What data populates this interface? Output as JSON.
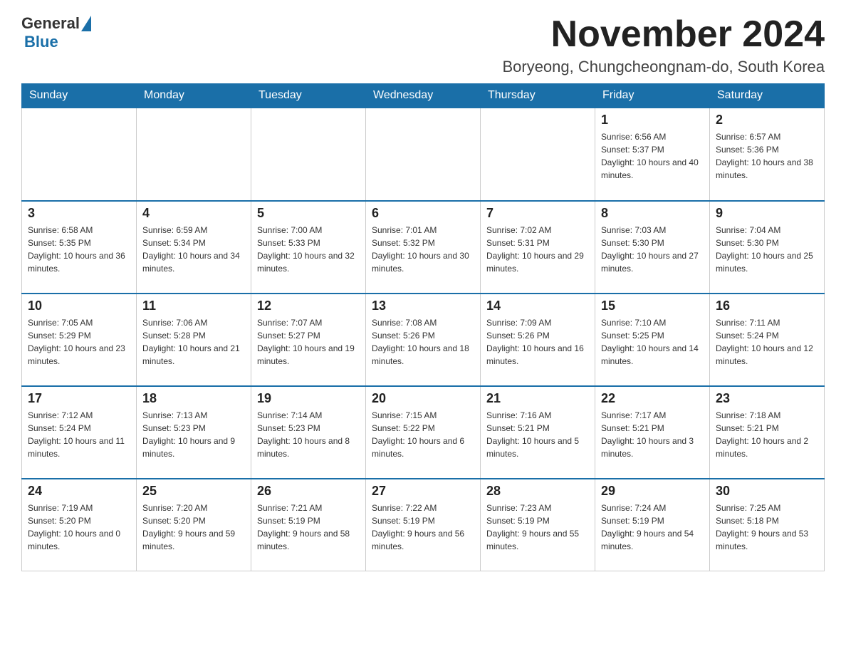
{
  "header": {
    "logo": {
      "general": "General",
      "blue": "Blue"
    },
    "title": "November 2024",
    "location": "Boryeong, Chungcheongnam-do, South Korea"
  },
  "columns": [
    "Sunday",
    "Monday",
    "Tuesday",
    "Wednesday",
    "Thursday",
    "Friday",
    "Saturday"
  ],
  "weeks": [
    [
      {
        "day": "",
        "sunrise": "",
        "sunset": "",
        "daylight": ""
      },
      {
        "day": "",
        "sunrise": "",
        "sunset": "",
        "daylight": ""
      },
      {
        "day": "",
        "sunrise": "",
        "sunset": "",
        "daylight": ""
      },
      {
        "day": "",
        "sunrise": "",
        "sunset": "",
        "daylight": ""
      },
      {
        "day": "",
        "sunrise": "",
        "sunset": "",
        "daylight": ""
      },
      {
        "day": "1",
        "sunrise": "Sunrise: 6:56 AM",
        "sunset": "Sunset: 5:37 PM",
        "daylight": "Daylight: 10 hours and 40 minutes."
      },
      {
        "day": "2",
        "sunrise": "Sunrise: 6:57 AM",
        "sunset": "Sunset: 5:36 PM",
        "daylight": "Daylight: 10 hours and 38 minutes."
      }
    ],
    [
      {
        "day": "3",
        "sunrise": "Sunrise: 6:58 AM",
        "sunset": "Sunset: 5:35 PM",
        "daylight": "Daylight: 10 hours and 36 minutes."
      },
      {
        "day": "4",
        "sunrise": "Sunrise: 6:59 AM",
        "sunset": "Sunset: 5:34 PM",
        "daylight": "Daylight: 10 hours and 34 minutes."
      },
      {
        "day": "5",
        "sunrise": "Sunrise: 7:00 AM",
        "sunset": "Sunset: 5:33 PM",
        "daylight": "Daylight: 10 hours and 32 minutes."
      },
      {
        "day": "6",
        "sunrise": "Sunrise: 7:01 AM",
        "sunset": "Sunset: 5:32 PM",
        "daylight": "Daylight: 10 hours and 30 minutes."
      },
      {
        "day": "7",
        "sunrise": "Sunrise: 7:02 AM",
        "sunset": "Sunset: 5:31 PM",
        "daylight": "Daylight: 10 hours and 29 minutes."
      },
      {
        "day": "8",
        "sunrise": "Sunrise: 7:03 AM",
        "sunset": "Sunset: 5:30 PM",
        "daylight": "Daylight: 10 hours and 27 minutes."
      },
      {
        "day": "9",
        "sunrise": "Sunrise: 7:04 AM",
        "sunset": "Sunset: 5:30 PM",
        "daylight": "Daylight: 10 hours and 25 minutes."
      }
    ],
    [
      {
        "day": "10",
        "sunrise": "Sunrise: 7:05 AM",
        "sunset": "Sunset: 5:29 PM",
        "daylight": "Daylight: 10 hours and 23 minutes."
      },
      {
        "day": "11",
        "sunrise": "Sunrise: 7:06 AM",
        "sunset": "Sunset: 5:28 PM",
        "daylight": "Daylight: 10 hours and 21 minutes."
      },
      {
        "day": "12",
        "sunrise": "Sunrise: 7:07 AM",
        "sunset": "Sunset: 5:27 PM",
        "daylight": "Daylight: 10 hours and 19 minutes."
      },
      {
        "day": "13",
        "sunrise": "Sunrise: 7:08 AM",
        "sunset": "Sunset: 5:26 PM",
        "daylight": "Daylight: 10 hours and 18 minutes."
      },
      {
        "day": "14",
        "sunrise": "Sunrise: 7:09 AM",
        "sunset": "Sunset: 5:26 PM",
        "daylight": "Daylight: 10 hours and 16 minutes."
      },
      {
        "day": "15",
        "sunrise": "Sunrise: 7:10 AM",
        "sunset": "Sunset: 5:25 PM",
        "daylight": "Daylight: 10 hours and 14 minutes."
      },
      {
        "day": "16",
        "sunrise": "Sunrise: 7:11 AM",
        "sunset": "Sunset: 5:24 PM",
        "daylight": "Daylight: 10 hours and 12 minutes."
      }
    ],
    [
      {
        "day": "17",
        "sunrise": "Sunrise: 7:12 AM",
        "sunset": "Sunset: 5:24 PM",
        "daylight": "Daylight: 10 hours and 11 minutes."
      },
      {
        "day": "18",
        "sunrise": "Sunrise: 7:13 AM",
        "sunset": "Sunset: 5:23 PM",
        "daylight": "Daylight: 10 hours and 9 minutes."
      },
      {
        "day": "19",
        "sunrise": "Sunrise: 7:14 AM",
        "sunset": "Sunset: 5:23 PM",
        "daylight": "Daylight: 10 hours and 8 minutes."
      },
      {
        "day": "20",
        "sunrise": "Sunrise: 7:15 AM",
        "sunset": "Sunset: 5:22 PM",
        "daylight": "Daylight: 10 hours and 6 minutes."
      },
      {
        "day": "21",
        "sunrise": "Sunrise: 7:16 AM",
        "sunset": "Sunset: 5:21 PM",
        "daylight": "Daylight: 10 hours and 5 minutes."
      },
      {
        "day": "22",
        "sunrise": "Sunrise: 7:17 AM",
        "sunset": "Sunset: 5:21 PM",
        "daylight": "Daylight: 10 hours and 3 minutes."
      },
      {
        "day": "23",
        "sunrise": "Sunrise: 7:18 AM",
        "sunset": "Sunset: 5:21 PM",
        "daylight": "Daylight: 10 hours and 2 minutes."
      }
    ],
    [
      {
        "day": "24",
        "sunrise": "Sunrise: 7:19 AM",
        "sunset": "Sunset: 5:20 PM",
        "daylight": "Daylight: 10 hours and 0 minutes."
      },
      {
        "day": "25",
        "sunrise": "Sunrise: 7:20 AM",
        "sunset": "Sunset: 5:20 PM",
        "daylight": "Daylight: 9 hours and 59 minutes."
      },
      {
        "day": "26",
        "sunrise": "Sunrise: 7:21 AM",
        "sunset": "Sunset: 5:19 PM",
        "daylight": "Daylight: 9 hours and 58 minutes."
      },
      {
        "day": "27",
        "sunrise": "Sunrise: 7:22 AM",
        "sunset": "Sunset: 5:19 PM",
        "daylight": "Daylight: 9 hours and 56 minutes."
      },
      {
        "day": "28",
        "sunrise": "Sunrise: 7:23 AM",
        "sunset": "Sunset: 5:19 PM",
        "daylight": "Daylight: 9 hours and 55 minutes."
      },
      {
        "day": "29",
        "sunrise": "Sunrise: 7:24 AM",
        "sunset": "Sunset: 5:19 PM",
        "daylight": "Daylight: 9 hours and 54 minutes."
      },
      {
        "day": "30",
        "sunrise": "Sunrise: 7:25 AM",
        "sunset": "Sunset: 5:18 PM",
        "daylight": "Daylight: 9 hours and 53 minutes."
      }
    ]
  ]
}
